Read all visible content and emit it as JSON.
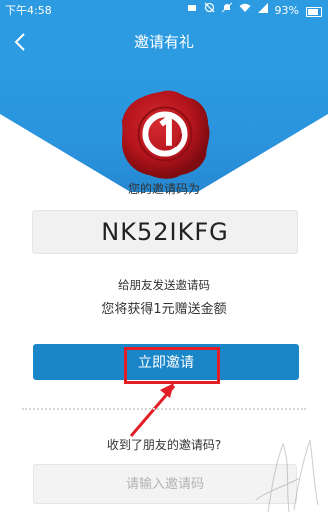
{
  "status_bar": {
    "time": "下午4:58",
    "battery": "93%",
    "icons": [
      "message-icon",
      "alarm-off-icon",
      "mute-icon",
      "wifi-icon",
      "cellular-signal-icon",
      "battery-icon"
    ]
  },
  "title_bar": {
    "title": "邀请有礼",
    "back_icon": "chevron-left-icon"
  },
  "invite": {
    "label": "您的邀请码为",
    "code": "NK52IKFG",
    "hint_line1": "给朋友发送邀请码",
    "hint_line2": "您将获得1元赠送金额",
    "button_label": "立即邀请"
  },
  "redeem": {
    "question": "收到了朋友的邀请码?",
    "placeholder": "请输入邀请码"
  },
  "colors": {
    "brand_blue": "#2c9be1",
    "button_blue": "#1a86c8",
    "seal_red": "#b4141c",
    "annotation_red": "#e21f26"
  }
}
